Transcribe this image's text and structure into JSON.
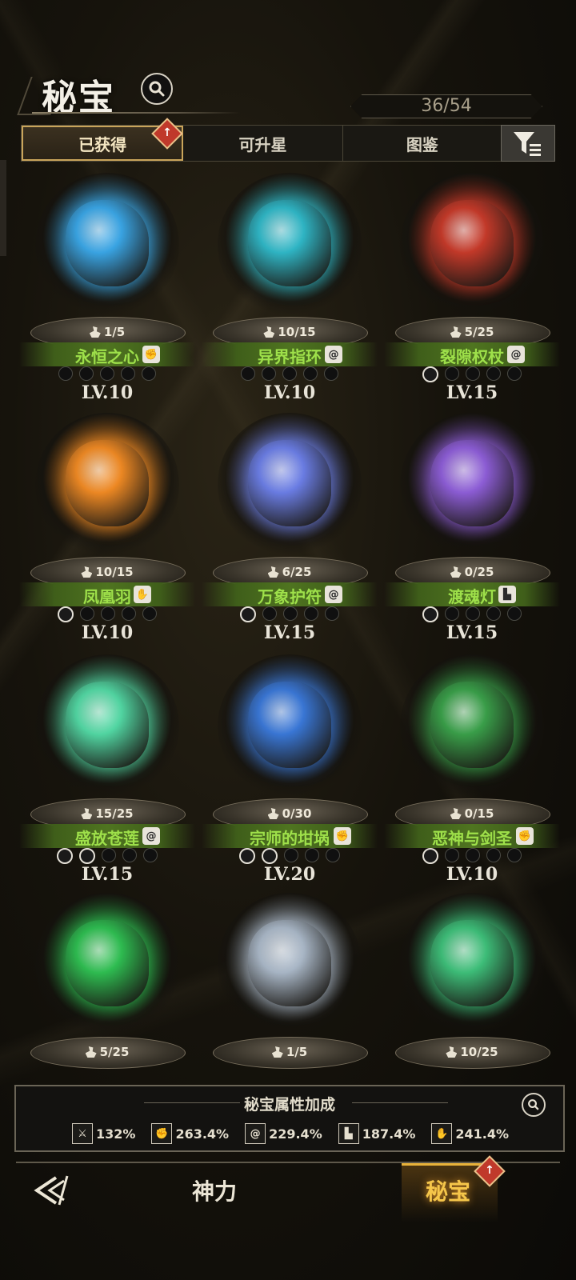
{
  "header": {
    "title": "秘宝",
    "counter": "36/54"
  },
  "tabs": [
    {
      "label": "已获得",
      "active": true,
      "badge": "↑"
    },
    {
      "label": "可升星",
      "active": false
    },
    {
      "label": "图鉴",
      "active": false
    }
  ],
  "items": [
    {
      "name": "永恒之心",
      "fragments": "1/5",
      "level": "LV.10",
      "stars_total": 5,
      "stars_filled": 0,
      "art": "blue-gem-heart",
      "color": "#3aa6e6"
    },
    {
      "name": "异界指环",
      "fragments": "10/15",
      "level": "LV.10",
      "stars_total": 5,
      "stars_filled": 0,
      "art": "teal-ring",
      "color": "#2fb7c7"
    },
    {
      "name": "裂隙权杖",
      "fragments": "5/25",
      "level": "LV.15",
      "stars_total": 5,
      "stars_filled": 1,
      "art": "red-wing-scepter",
      "color": "#c63a2a"
    },
    {
      "name": "凤凰羽",
      "fragments": "10/15",
      "level": "LV.10",
      "stars_total": 5,
      "stars_filled": 1,
      "art": "phoenix-feather",
      "color": "#f08a24"
    },
    {
      "name": "万象护符",
      "fragments": "6/25",
      "level": "LV.15",
      "stars_total": 5,
      "stars_filled": 1,
      "art": "sapphire-amulet",
      "color": "#6b7ee6"
    },
    {
      "name": "渡魂灯",
      "fragments": "0/25",
      "level": "LV.15",
      "stars_total": 5,
      "stars_filled": 1,
      "art": "soul-lantern",
      "color": "#8e5ed8"
    },
    {
      "name": "盛放苍莲",
      "fragments": "15/25",
      "level": "LV.15",
      "stars_total": 5,
      "stars_filled": 2,
      "art": "jade-lotus",
      "color": "#52d8a4"
    },
    {
      "name": "宗师的坩埚",
      "fragments": "0/30",
      "level": "LV.20",
      "stars_total": 5,
      "stars_filled": 2,
      "art": "cauldron",
      "color": "#3a78d8"
    },
    {
      "name": "恶神与剑圣",
      "fragments": "0/15",
      "level": "LV.10",
      "stars_total": 5,
      "stars_filled": 1,
      "art": "demon-swordsman",
      "color": "#3aa04a"
    },
    {
      "name": "",
      "fragments": "5/25",
      "level": "",
      "stars_total": 0,
      "stars_filled": 0,
      "art": "shattered-warrior",
      "color": "#2fbf52"
    },
    {
      "name": "",
      "fragments": "1/5",
      "level": "",
      "stars_total": 0,
      "stars_filled": 0,
      "art": "shattered-castle",
      "color": "#aab8c8"
    },
    {
      "name": "",
      "fragments": "10/25",
      "level": "",
      "stars_total": 0,
      "stars_filled": 0,
      "art": "shattered-traveler",
      "color": "#3ec07a"
    }
  ],
  "bonus": {
    "title": "秘宝属性加成",
    "stats": [
      {
        "icon": "sword-icon",
        "value": "132%"
      },
      {
        "icon": "fist-icon",
        "value": "263.4%"
      },
      {
        "icon": "vortex-icon",
        "value": "229.4%"
      },
      {
        "icon": "boot-icon",
        "value": "187.4%"
      },
      {
        "icon": "hand-icon",
        "value": "241.4%"
      }
    ]
  },
  "nav": [
    {
      "label": "神力",
      "active": false
    },
    {
      "label": "秘宝",
      "active": true,
      "badge": "↑"
    }
  ]
}
